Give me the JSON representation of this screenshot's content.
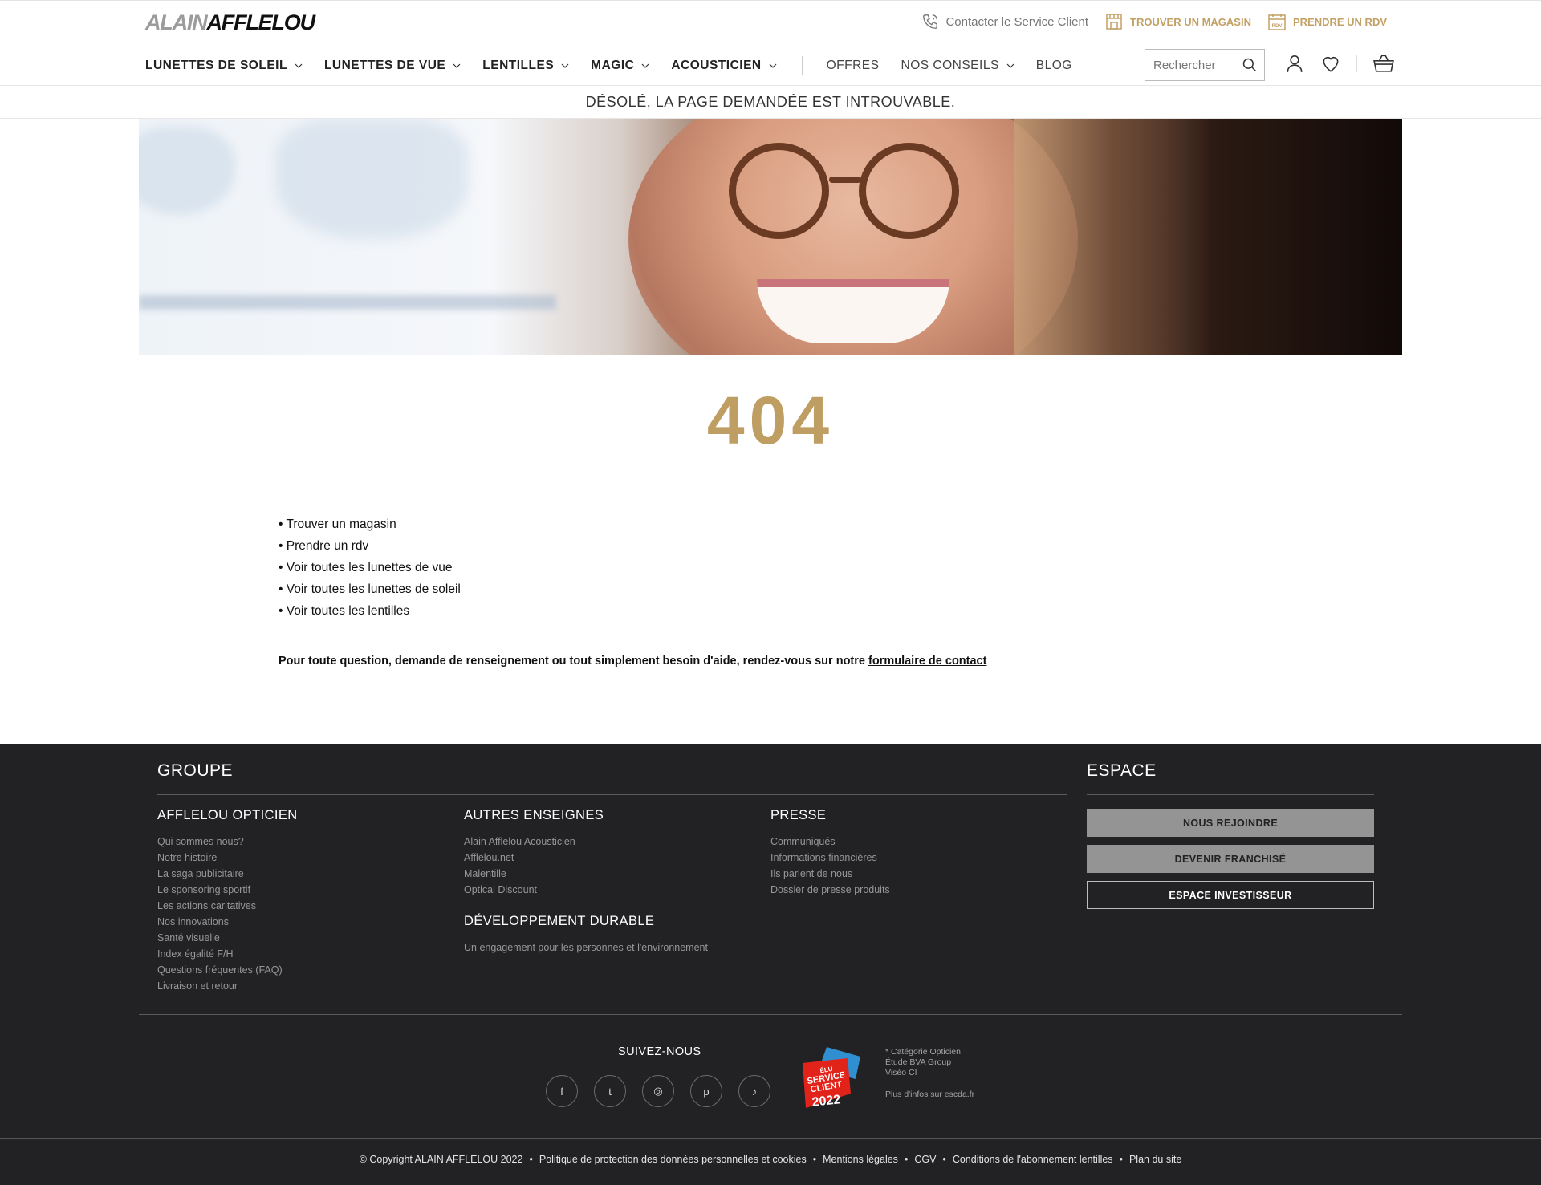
{
  "header": {
    "logo_light": "ALAIN",
    "logo_dark": "AFFLELOU",
    "contact_label": "Contacter le Service Client",
    "store_label": "TROUVER UN MAGASIN",
    "rdv_label": "PRENDRE UN RDV",
    "rdv_icon_text": "RDV"
  },
  "nav": {
    "items": [
      {
        "label": "LUNETTES DE SOLEIL"
      },
      {
        "label": "LUNETTES DE VUE"
      },
      {
        "label": "LENTILLES"
      },
      {
        "label": "MAGIC"
      },
      {
        "label": "ACOUSTICIEN"
      }
    ],
    "offres": "OFFRES",
    "conseils": "NOS CONSEILS",
    "blog": "BLOG",
    "search_placeholder": "Rechercher"
  },
  "error_banner": "DÉSOLÉ, LA PAGE DEMANDÉE EST INTROUVABLE.",
  "error_code": "404",
  "quick_links": [
    "• Trouver un magasin",
    "• Prendre un rdv",
    "• Voir toutes les lunettes de vue",
    "• Voir toutes les lunettes de soleil",
    "• Voir toutes les lentilles"
  ],
  "help": {
    "text": "Pour toute question, demande de renseignement ou tout simplement besoin d'aide, rendez-vous sur notre ",
    "link": "formulaire de contact"
  },
  "footer": {
    "groupe_title": "GROUPE",
    "espace_title": "ESPACE",
    "col1": {
      "title": "AFFLELOU OPTICIEN",
      "links": [
        "Qui sommes nous?",
        "Notre histoire",
        "La saga publicitaire",
        "Le sponsoring sportif",
        "Les actions caritatives",
        "Nos innovations",
        "Santé visuelle",
        "Index égalité F/H",
        "Questions fréquentes (FAQ)",
        "Livraison et retour"
      ]
    },
    "col2": {
      "title": "AUTRES ENSEIGNES",
      "links": [
        "Alain Afflelou Acousticien",
        "Afflelou.net",
        "Malentille",
        "Optical Discount"
      ]
    },
    "col2b": {
      "title": "DÉVELOPPEMENT DURABLE",
      "links": [
        "Un engagement pour les personnes et l'environnement"
      ]
    },
    "col3": {
      "title": "PRESSE",
      "links": [
        "Communiqués",
        "Informations financières",
        "Ils parlent de nous",
        "Dossier de presse produits"
      ]
    },
    "buttons": [
      "NOUS REJOINDRE",
      "DEVENIR FRANCHISÉ",
      "ESPACE INVESTISSEUR"
    ],
    "follow": "SUIVEZ-NOUS",
    "socials": [
      {
        "icon": "facebook-icon",
        "glyph": "f"
      },
      {
        "icon": "twitter-icon",
        "glyph": "t"
      },
      {
        "icon": "instagram-icon",
        "glyph": "◎"
      },
      {
        "icon": "pinterest-icon",
        "glyph": "p"
      },
      {
        "icon": "tiktok-icon",
        "glyph": "♪"
      }
    ],
    "award": {
      "line1": "ÉLU",
      "line2": "SERVICE",
      "line3": "CLIENT",
      "year": "2022"
    },
    "award_note": [
      "* Catégorie Opticien",
      "Étude BVA Group",
      "Viséo CI"
    ],
    "award_more": "Plus d'infos sur escda.fr",
    "copyright_items": [
      "© Copyright ALAIN AFFLELOU 2022",
      "Politique de protection des données personnelles et cookies",
      "Mentions légales",
      "CGV",
      "Conditions de l'abonnement lentilles",
      "Plan du site"
    ]
  },
  "colors": {
    "gold": "#bf9e63",
    "footer_bg": "#222225",
    "button_grey": "#949494"
  }
}
